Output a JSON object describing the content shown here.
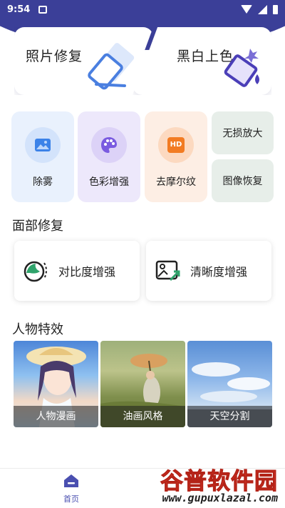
{
  "statusbar": {
    "time": "9:54"
  },
  "feature_cards": {
    "photo_repair": "照片修复",
    "colorize": "黑白上色"
  },
  "tools": {
    "dehaze": "除雾",
    "color_enhance": "色彩增强",
    "demoire": "去摩尔纹",
    "lossless_zoom": "无损放大",
    "image_restore": "图像恢复",
    "hd_badge": "HD"
  },
  "face_section": {
    "title": "面部修复",
    "contrast": "对比度增强",
    "clarity": "清晰度增强"
  },
  "effects_section": {
    "title": "人物特效",
    "items": [
      "人物漫画",
      "油画风格",
      "天空分割"
    ]
  },
  "bottom_nav": {
    "home": "首页"
  },
  "watermark": {
    "cn": "谷普软件园",
    "url": "www.gupuxlazal.com"
  },
  "colors": {
    "brand": "#3b3f98",
    "accent": "#4a4fb0"
  }
}
